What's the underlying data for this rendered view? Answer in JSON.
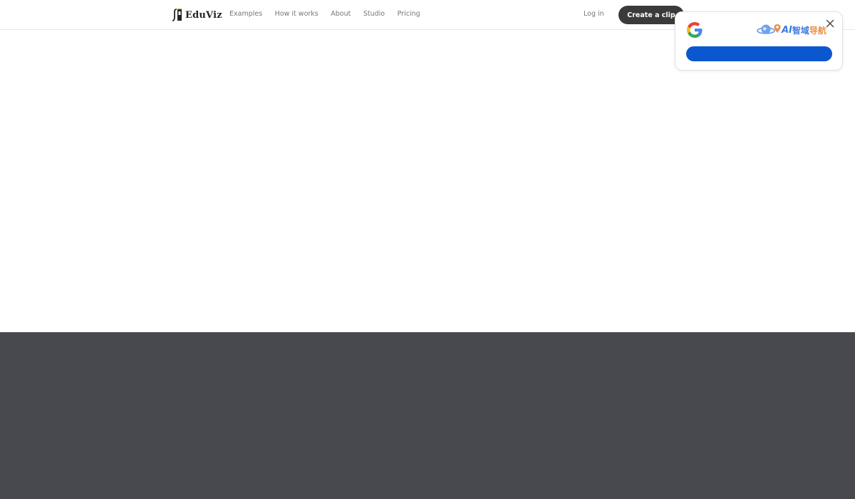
{
  "header": {
    "brand": "EduViz",
    "nav": [
      "Examples",
      "How it works",
      "About",
      "Studio",
      "Pricing"
    ],
    "login_label": "Log in",
    "cta_label": "Create a clip"
  },
  "popup": {
    "brand_ai": "AI",
    "brand_cn_part1": "智域",
    "brand_cn_part2": "导航",
    "icons": [
      "google-g-icon",
      "globe-location-icon",
      "close-icon"
    ],
    "button_color": "#0b57d0"
  },
  "colors": {
    "dark_band": "#48494e",
    "cta_bg": "#3a3a3a",
    "nav_text": "#777777"
  }
}
